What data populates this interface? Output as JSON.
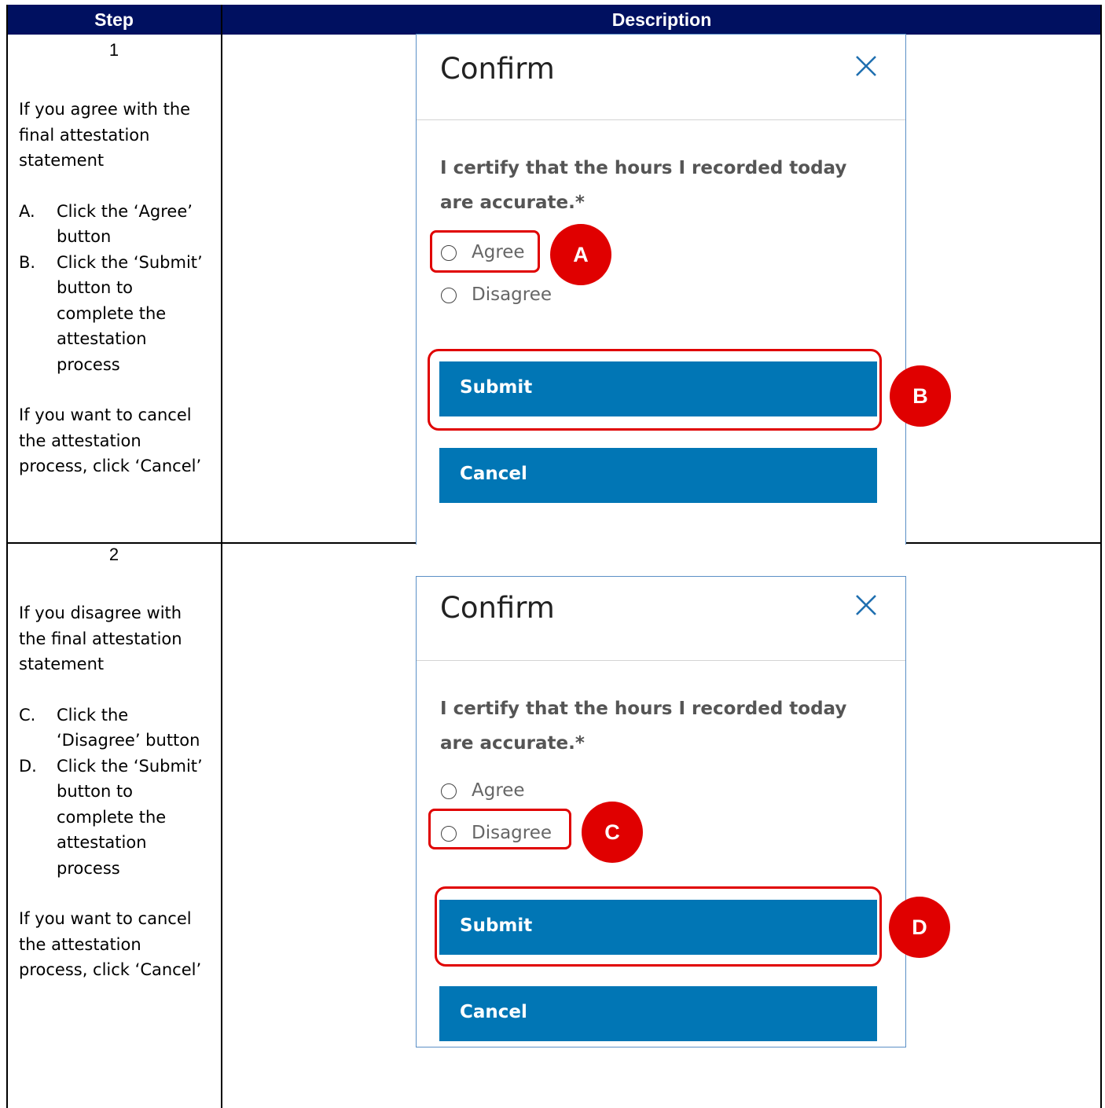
{
  "table": {
    "headers": {
      "step": "Step",
      "description": "Description"
    }
  },
  "rows": [
    {
      "step_number": "1",
      "intro": "If you agree with the final attestation statement",
      "items": [
        {
          "marker": "A.",
          "text": "Click the ‘Agree’ button"
        },
        {
          "marker": "B.",
          "text": "Click the ‘Submit’ button to complete the attestation process"
        }
      ],
      "outro": "If you want to cancel the attestation process, click ‘Cancel’",
      "modal": {
        "title": "Confirm",
        "close_icon": "close-icon",
        "question": "I certify that the hours I recorded today are accurate.*",
        "options": [
          "Agree",
          "Disagree"
        ],
        "submit_label": "Submit",
        "cancel_label": "Cancel"
      },
      "callouts": [
        "A",
        "B"
      ]
    },
    {
      "step_number": "2",
      "intro": "If you disagree with the final attestation statement",
      "items": [
        {
          "marker": "C.",
          "text": "Click the ‘Disagree’ button"
        },
        {
          "marker": "D.",
          "text": "Click the ‘Submit’ button to complete the attestation process"
        }
      ],
      "outro": "If you want to cancel the attestation process, click ‘Cancel’",
      "modal": {
        "title": "Confirm",
        "close_icon": "close-icon",
        "question": "I certify that the hours I recorded today are accurate.*",
        "options": [
          "Agree",
          "Disagree"
        ],
        "submit_label": "Submit",
        "cancel_label": "Cancel"
      },
      "callouts": [
        "C",
        "D"
      ]
    }
  ],
  "colors": {
    "header_bg": "#001060",
    "button_bg": "#0176b5",
    "callout_red": "#e00000",
    "modal_border": "#5b8fc6"
  }
}
